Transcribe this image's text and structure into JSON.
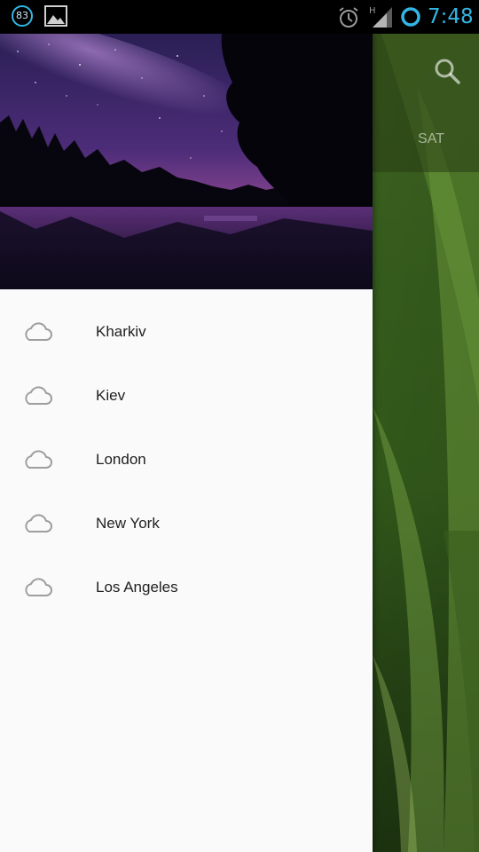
{
  "status_bar": {
    "notification_count": "83",
    "time": "7:48",
    "icons": [
      "notification-badge-icon",
      "image-icon",
      "alarm-icon",
      "signal-icon",
      "sync-icon"
    ],
    "accent_color": "#33b5e5"
  },
  "background_app": {
    "search_icon": "search-icon",
    "visible_tab": "SAT"
  },
  "drawer": {
    "header_image": "night-sky-lake-image",
    "cities": [
      {
        "label": "Kharkiv",
        "icon": "cloud-icon"
      },
      {
        "label": "Kiev",
        "icon": "cloud-icon"
      },
      {
        "label": "London",
        "icon": "cloud-icon"
      },
      {
        "label": "New York",
        "icon": "cloud-icon"
      },
      {
        "label": "Los Angeles",
        "icon": "cloud-icon"
      }
    ]
  }
}
